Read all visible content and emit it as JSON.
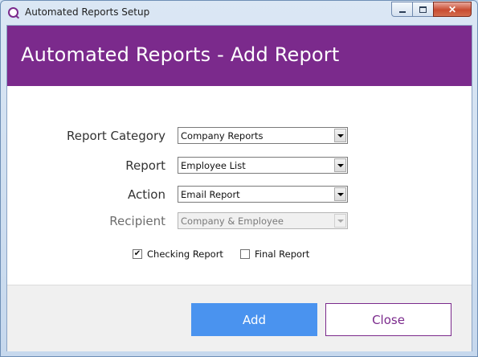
{
  "window": {
    "title": "Automated Reports Setup",
    "controls": {
      "minimize_icon": "minimize-icon",
      "maximize_icon": "maximize-icon",
      "close_glyph": "✕"
    }
  },
  "header": {
    "title": "Automated Reports - Add Report",
    "background": "#7b2a8c"
  },
  "form": {
    "report_category": {
      "label": "Report Category",
      "value": "Company Reports",
      "enabled": true
    },
    "report": {
      "label": "Report",
      "value": "Employee List",
      "enabled": true
    },
    "action": {
      "label": "Action",
      "value": "Email Report",
      "enabled": true
    },
    "recipient": {
      "label": "Recipient",
      "value": "Company & Employee",
      "enabled": false
    },
    "checking_report": {
      "label": "Checking Report",
      "checked": true,
      "mark": "✔"
    },
    "final_report": {
      "label": "Final Report",
      "checked": false,
      "mark": ""
    }
  },
  "buttons": {
    "add": {
      "label": "Add",
      "color": "#4a93ef"
    },
    "close": {
      "label": "Close",
      "color": "#7b2a8c"
    }
  }
}
